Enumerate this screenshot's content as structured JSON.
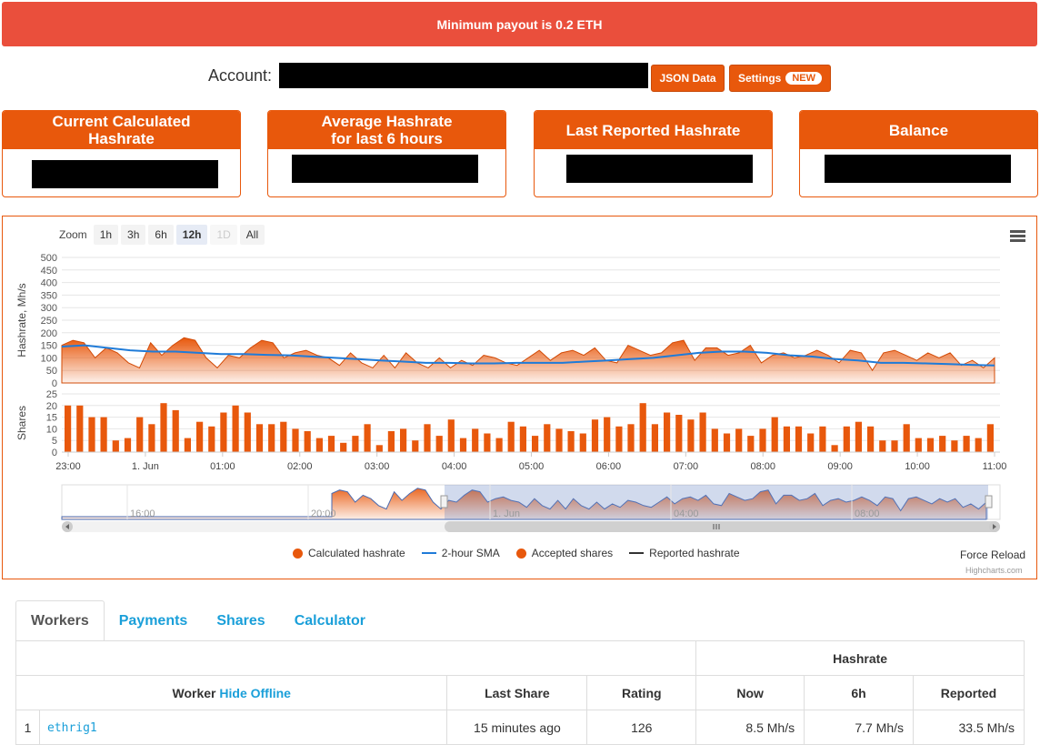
{
  "alert": {
    "text": "Minimum payout is 0.2 ETH"
  },
  "account": {
    "label": "Account:",
    "json_button": "JSON Data",
    "settings_button": "Settings",
    "settings_badge": "NEW"
  },
  "stats": [
    {
      "title": "Current Calculated\nHashrate"
    },
    {
      "title": "Average Hashrate\nfor last 6 hours"
    },
    {
      "title": "Last Reported Hashrate"
    },
    {
      "title": "Balance"
    }
  ],
  "zoom": {
    "label": "Zoom",
    "buttons": [
      "1h",
      "3h",
      "6h",
      "12h",
      "1D",
      "All"
    ],
    "active": "12h",
    "disabled": [
      "1D"
    ]
  },
  "legend": {
    "calc": "Calculated hashrate",
    "sma": "2-hour SMA",
    "shares": "Accepted shares",
    "reported": "Reported hashrate"
  },
  "chart_actions": {
    "force_reload": "Force Reload",
    "credits": "Highcharts.com"
  },
  "colors": {
    "accent": "#e8580c",
    "sma": "#1f7bd8",
    "link": "#1a9fd9",
    "alert": "#ea4f3c"
  },
  "chart_data": {
    "type": "area",
    "x_tick_labels": [
      "23:00",
      "1. Jun",
      "01:00",
      "02:00",
      "03:00",
      "04:00",
      "05:00",
      "06:00",
      "07:00",
      "08:00",
      "09:00",
      "10:00",
      "11:00"
    ],
    "hashrate": {
      "ylabel": "Hashrate, Mh/s",
      "ylim": [
        0,
        500
      ],
      "yticks": [
        0,
        50,
        100,
        150,
        200,
        250,
        300,
        350,
        400,
        450,
        500
      ],
      "series": [
        {
          "name": "Calculated hashrate",
          "values": [
            150,
            170,
            160,
            100,
            140,
            120,
            80,
            60,
            160,
            110,
            150,
            180,
            170,
            100,
            60,
            110,
            100,
            140,
            170,
            160,
            100,
            120,
            130,
            110,
            100,
            70,
            120,
            80,
            60,
            110,
            60,
            120,
            80,
            60,
            100,
            60,
            90,
            70,
            110,
            100,
            80,
            70,
            100,
            130,
            90,
            120,
            130,
            110,
            140,
            90,
            80,
            150,
            130,
            110,
            120,
            160,
            170,
            90,
            140,
            140,
            110,
            120,
            150,
            80,
            110,
            120,
            100,
            110,
            130,
            110,
            80,
            130,
            120,
            50,
            120,
            130,
            110,
            90,
            120,
            100,
            120,
            70,
            90,
            60,
            100
          ]
        },
        {
          "name": "2-hour SMA",
          "values": [
            145,
            150,
            140,
            130,
            125,
            125,
            120,
            115,
            115,
            112,
            110,
            105,
            100,
            95,
            90,
            85,
            80,
            80,
            78,
            78,
            80,
            80,
            80,
            85,
            90,
            95,
            100,
            110,
            120,
            125,
            125,
            120,
            110,
            105,
            95,
            90,
            80,
            80,
            78,
            75,
            72,
            70
          ]
        }
      ]
    },
    "shares": {
      "ylabel": "Shares",
      "ylim": [
        0,
        25
      ],
      "yticks": [
        0,
        5,
        10,
        15,
        20,
        25
      ],
      "series": [
        {
          "name": "Accepted shares",
          "values": [
            20,
            20,
            15,
            15,
            5,
            6,
            15,
            12,
            21,
            18,
            6,
            13,
            11,
            17,
            20,
            17,
            12,
            12,
            13,
            10,
            9,
            6,
            7,
            4,
            7,
            12,
            3,
            9,
            10,
            5,
            12,
            7,
            14,
            6,
            10,
            8,
            6,
            13,
            11,
            7,
            12,
            10,
            9,
            8,
            14,
            15,
            11,
            12,
            21,
            12,
            17,
            16,
            14,
            17,
            10,
            8,
            10,
            7,
            10,
            15,
            11,
            11,
            8,
            11,
            3,
            11,
            13,
            11,
            5,
            5,
            12,
            6,
            6,
            7,
            5,
            7,
            6,
            12
          ]
        }
      ]
    },
    "navigator": {
      "tick_labels": [
        "16:00",
        "20:00",
        "1. Jun",
        "04:00",
        "08:00"
      ]
    }
  },
  "tabs": [
    "Workers",
    "Payments",
    "Shares",
    "Calculator"
  ],
  "table": {
    "group_header": "Hashrate",
    "headers": {
      "worker": "Worker",
      "hide_offline": "Hide Offline",
      "last_share": "Last Share",
      "rating": "Rating",
      "now": "Now",
      "h6": "6h",
      "reported": "Reported"
    },
    "rows": [
      {
        "index": "1",
        "worker": "ethrig1",
        "last_share": "15 minutes ago",
        "rating": "126",
        "now": "8.5 Mh/s",
        "h6": "7.7 Mh/s",
        "reported": "33.5 Mh/s"
      }
    ]
  }
}
